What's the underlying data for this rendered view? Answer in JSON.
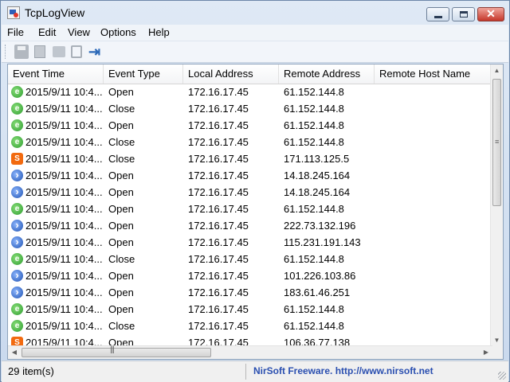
{
  "window": {
    "title": "TcpLogView"
  },
  "menu": [
    "File",
    "Edit",
    "View",
    "Options",
    "Help"
  ],
  "columns": [
    "Event Time",
    "Event Type",
    "Local Address",
    "Remote Address",
    "Remote Host Name"
  ],
  "rows": [
    {
      "icon": "ie-icon",
      "time": "2015/9/11 10:4...",
      "type": "Open",
      "local": "172.16.17.45",
      "remote": "61.152.144.8"
    },
    {
      "icon": "ie-icon",
      "time": "2015/9/11 10:4...",
      "type": "Close",
      "local": "172.16.17.45",
      "remote": "61.152.144.8"
    },
    {
      "icon": "ie-icon",
      "time": "2015/9/11 10:4...",
      "type": "Open",
      "local": "172.16.17.45",
      "remote": "61.152.144.8"
    },
    {
      "icon": "ie-icon",
      "time": "2015/9/11 10:4...",
      "type": "Close",
      "local": "172.16.17.45",
      "remote": "61.152.144.8"
    },
    {
      "icon": "sogou-icon",
      "time": "2015/9/11 10:4...",
      "type": "Close",
      "local": "172.16.17.45",
      "remote": "171.113.125.5"
    },
    {
      "icon": "blue-app-icon",
      "time": "2015/9/11 10:4...",
      "type": "Open",
      "local": "172.16.17.45",
      "remote": "14.18.245.164"
    },
    {
      "icon": "blue-app-icon",
      "time": "2015/9/11 10:4...",
      "type": "Open",
      "local": "172.16.17.45",
      "remote": "14.18.245.164"
    },
    {
      "icon": "ie-icon",
      "time": "2015/9/11 10:4...",
      "type": "Open",
      "local": "172.16.17.45",
      "remote": "61.152.144.8"
    },
    {
      "icon": "blue-app-icon",
      "time": "2015/9/11 10:4...",
      "type": "Open",
      "local": "172.16.17.45",
      "remote": "222.73.132.196"
    },
    {
      "icon": "blue-app-icon",
      "time": "2015/9/11 10:4...",
      "type": "Open",
      "local": "172.16.17.45",
      "remote": "115.231.191.143"
    },
    {
      "icon": "ie-icon",
      "time": "2015/9/11 10:4...",
      "type": "Close",
      "local": "172.16.17.45",
      "remote": "61.152.144.8"
    },
    {
      "icon": "blue-app-icon",
      "time": "2015/9/11 10:4...",
      "type": "Open",
      "local": "172.16.17.45",
      "remote": "101.226.103.86"
    },
    {
      "icon": "blue-app-icon",
      "time": "2015/9/11 10:4...",
      "type": "Open",
      "local": "172.16.17.45",
      "remote": "183.61.46.251"
    },
    {
      "icon": "ie-icon",
      "time": "2015/9/11 10:4...",
      "type": "Open",
      "local": "172.16.17.45",
      "remote": "61.152.144.8"
    },
    {
      "icon": "ie-icon",
      "time": "2015/9/11 10:4...",
      "type": "Close",
      "local": "172.16.17.45",
      "remote": "61.152.144.8"
    },
    {
      "icon": "sogou-icon",
      "time": "2015/9/11 10:4...",
      "type": "Open",
      "local": "172.16.17.45",
      "remote": "106.36.77.138"
    }
  ],
  "status": {
    "count": "29 item(s)",
    "credit": "NirSoft Freeware.  http://www.nirsoft.net"
  },
  "colors": {
    "link": "#2a4fb0",
    "titlebar": "#c9d9ee",
    "border": "#6b86a8"
  }
}
